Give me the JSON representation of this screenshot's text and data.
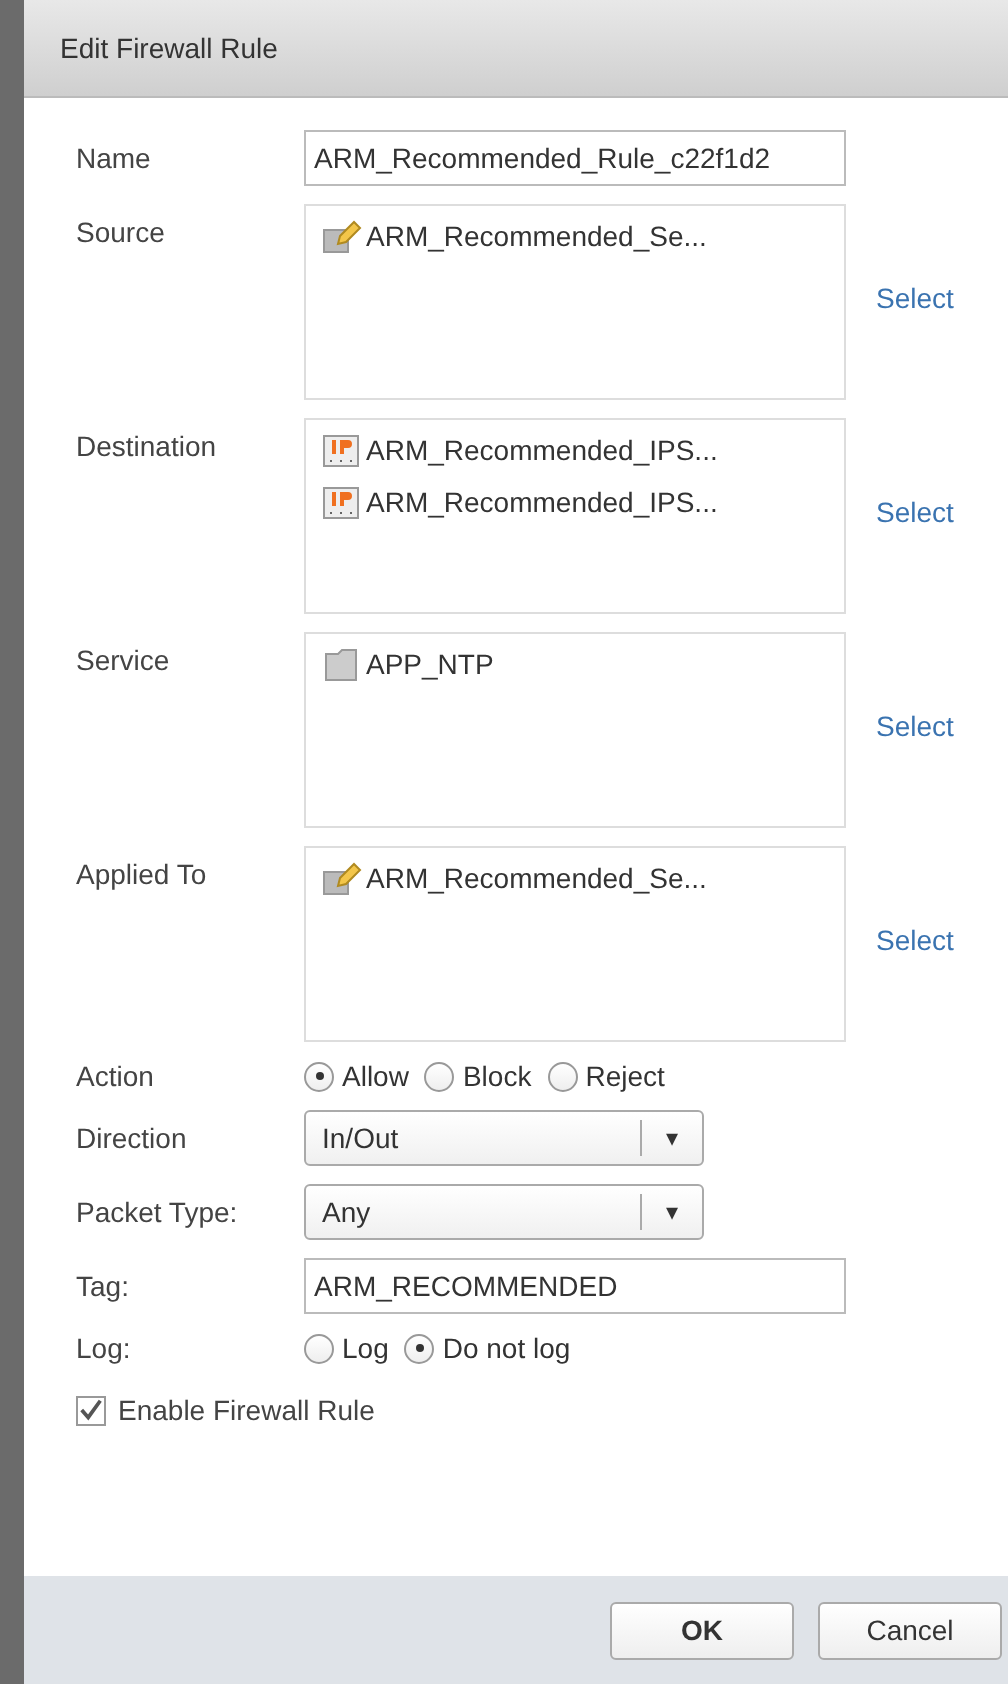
{
  "dialog": {
    "title": "Edit Firewall Rule"
  },
  "rows": [
    {
      "kind": "text",
      "label": "Name",
      "value": "ARM_Recommended_Rule_c22f1d2"
    },
    {
      "kind": "list",
      "label": "Source",
      "link": "Select",
      "items": [
        {
          "kind": "group",
          "text": "ARM_Recommended_Se..."
        }
      ]
    },
    {
      "kind": "list",
      "label": "Destination",
      "link": "Select",
      "items": [
        {
          "kind": "ip",
          "text": "ARM_Recommended_IPS..."
        },
        {
          "kind": "ip",
          "text": "ARM_Recommended_IPS..."
        }
      ]
    },
    {
      "kind": "list",
      "label": "Service",
      "link": "Select",
      "items": [
        {
          "kind": "service",
          "text": "APP_NTP"
        }
      ]
    },
    {
      "kind": "list",
      "label": "Applied To",
      "link": "Select",
      "items": [
        {
          "kind": "group",
          "text": "ARM_Recommended_Se..."
        }
      ]
    },
    {
      "kind": "radio",
      "label": "Action",
      "options": [
        {
          "text": "Allow",
          "selected": true
        },
        {
          "text": "Block",
          "selected": false
        },
        {
          "text": "Reject",
          "selected": false
        }
      ]
    },
    {
      "kind": "select",
      "label": "Direction",
      "value": "In/Out",
      "arrow": "▾"
    },
    {
      "kind": "select",
      "label": "Packet Type:",
      "value": "Any",
      "arrow": "▾"
    },
    {
      "kind": "text",
      "label": "Tag:",
      "value": "ARM_RECOMMENDED"
    },
    {
      "kind": "radio",
      "label": "Log:",
      "options": [
        {
          "text": "Log",
          "selected": false
        },
        {
          "text": "Do not log",
          "selected": true
        }
      ]
    }
  ],
  "enable": {
    "label": "Enable Firewall Rule",
    "checked": true
  },
  "buttons": [
    "OK",
    "Cancel"
  ]
}
